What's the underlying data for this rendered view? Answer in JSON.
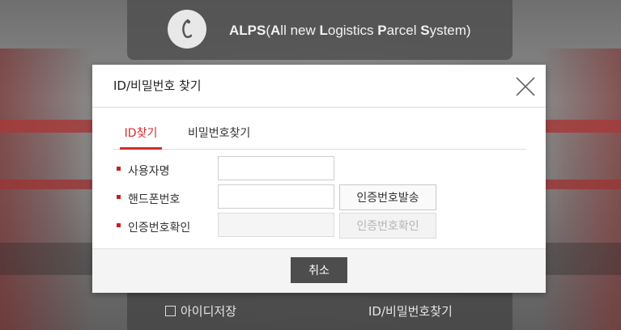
{
  "header": {
    "title_parts": [
      "ALPS",
      "(",
      "A",
      "ll new ",
      "L",
      "ogistics ",
      "P",
      "arcel ",
      "S",
      "ystem)"
    ],
    "logo_icon": "alps-logo-icon"
  },
  "login": {
    "remember_label": "아이디저장",
    "find_link": "ID/비밀번호찾기"
  },
  "modal": {
    "title": "ID/비밀번호 찾기",
    "tabs": [
      {
        "label": "ID찾기",
        "active": true
      },
      {
        "label": "비밀번호찾기",
        "active": false
      }
    ],
    "fields": {
      "name": {
        "label": "사용자명",
        "value": ""
      },
      "phone": {
        "label": "핸드폰번호",
        "value": "",
        "button": "인증번호발송"
      },
      "code": {
        "label": "인증번호확인",
        "value": "",
        "button": "인증번호확인",
        "disabled": true
      }
    },
    "cancel_label": "취소"
  },
  "colors": {
    "accent": "#d42b2b",
    "cancel_bg": "#4d4d4d"
  }
}
